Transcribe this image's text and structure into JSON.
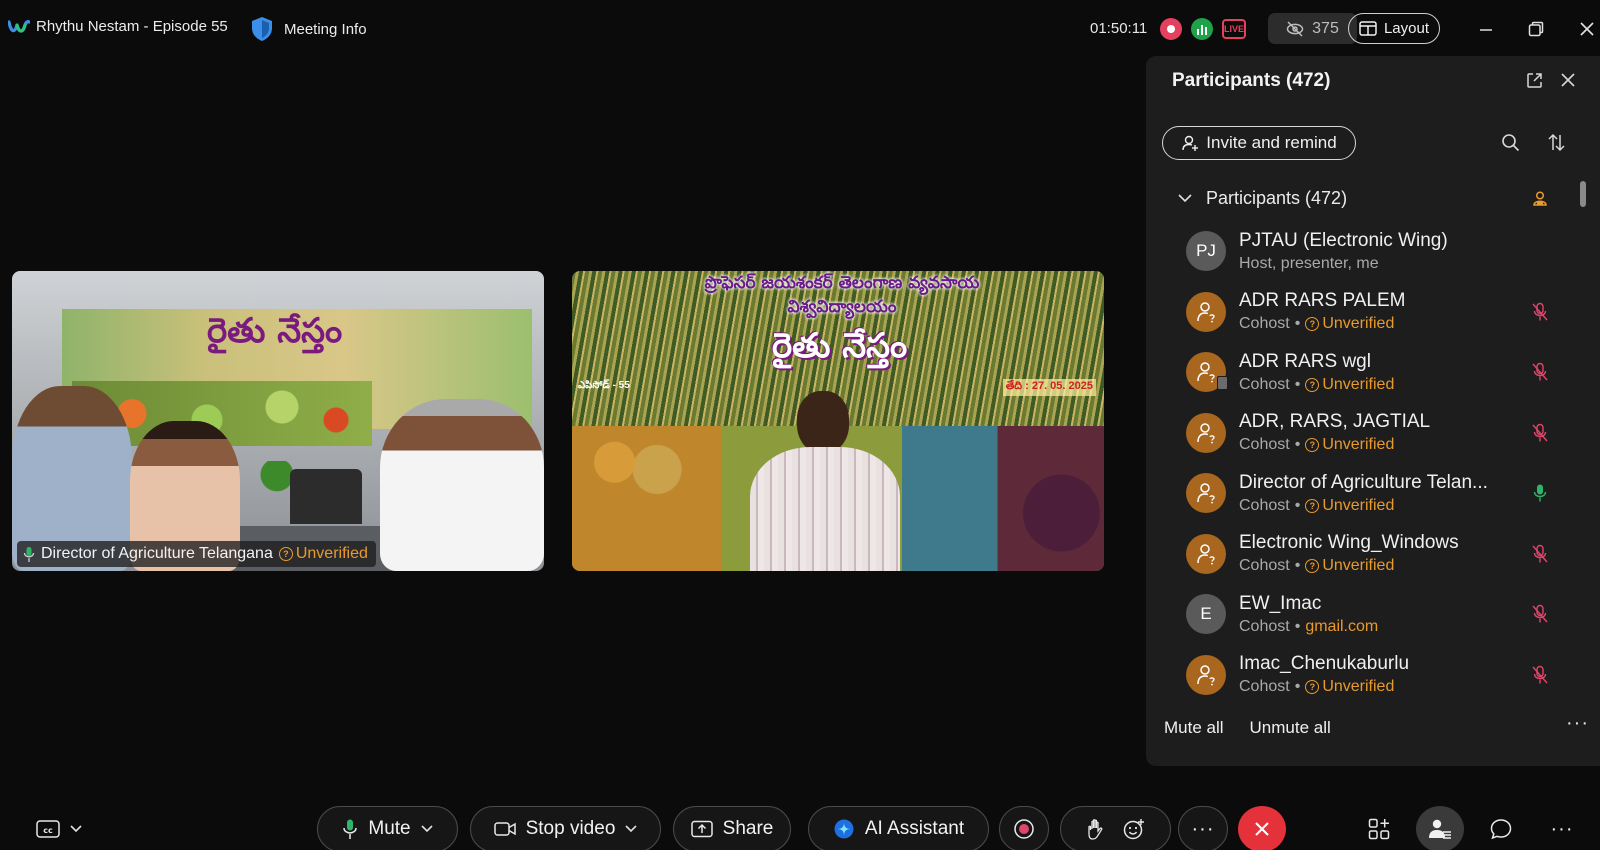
{
  "app": {
    "title": "Rhythu Nestam - Episode 55",
    "meeting_info": "Meeting Info",
    "clock": "01:50:11",
    "live": "LIVE",
    "viewers": "375",
    "layout_label": "Layout"
  },
  "videos": [
    {
      "participant": "Director of Agriculture Telangana",
      "status": "Unverified",
      "banner_title": "రైతు నేస్తం"
    },
    {
      "banner_header": "ప్రొఫెసర్ జయశంకర్ తెలంగాణ వ్యవసాయ విశ్వవిద్యాలయం",
      "banner_title": "రైతు నేస్తం",
      "banner_date": "తేది : 27. 05. 2025",
      "banner_episode": "ఎపిసోడ్ - 55"
    }
  ],
  "panel": {
    "title": "Participants (472)",
    "invite_label": "Invite and remind",
    "section_label": "Participants (472)",
    "participants": [
      {
        "name": "PJTAU (Electronic Wing)",
        "role": "Host, presenter, me",
        "tag": "",
        "avatar": "PJ",
        "avatar_type": "initials",
        "mic": "none"
      },
      {
        "name": "ADR RARS PALEM",
        "role": "Cohost",
        "tag": "Unverified",
        "avatar": "",
        "avatar_type": "guest",
        "mic": "muted"
      },
      {
        "name": "ADR RARS wgl",
        "role": "Cohost",
        "tag": "Unverified",
        "avatar": "",
        "avatar_type": "guest-device",
        "mic": "muted"
      },
      {
        "name": "ADR, RARS, JAGTIAL",
        "role": "Cohost",
        "tag": "Unverified",
        "avatar": "",
        "avatar_type": "guest",
        "mic": "muted"
      },
      {
        "name": "Director of Agriculture Telan...",
        "role": "Cohost",
        "tag": "Unverified",
        "avatar": "",
        "avatar_type": "guest",
        "mic": "active"
      },
      {
        "name": "Electronic Wing_Windows",
        "role": "Cohost",
        "tag": "Unverified",
        "avatar": "",
        "avatar_type": "guest",
        "mic": "muted"
      },
      {
        "name": "EW_Imac",
        "role": "Cohost",
        "tag": "gmail.com",
        "avatar": "E",
        "avatar_type": "initials",
        "mic": "muted"
      },
      {
        "name": "Imac_Chenukaburlu",
        "role": "Cohost",
        "tag": "Unverified",
        "avatar": "",
        "avatar_type": "guest",
        "mic": "muted"
      }
    ],
    "mute_all": "Mute all",
    "unmute_all": "Unmute all"
  },
  "controls": {
    "mute": "Mute",
    "stop_video": "Stop video",
    "share": "Share",
    "ai_assistant": "AI Assistant"
  },
  "colors": {
    "accent_orange": "#e89a2c",
    "muted_red": "#e0456a",
    "mic_green": "#2fb567",
    "end_red": "#e5323a"
  }
}
